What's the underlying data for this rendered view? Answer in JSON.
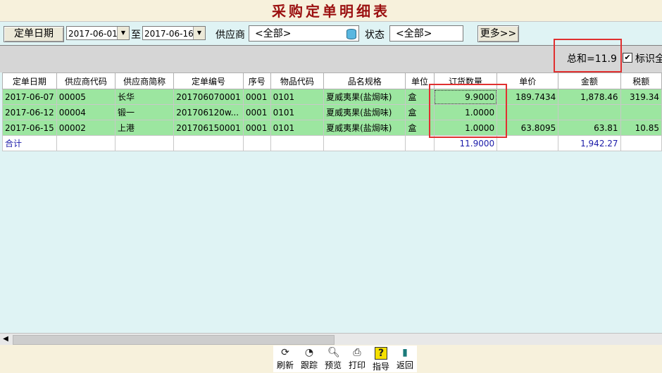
{
  "title": "采购定单明细表",
  "filters": {
    "date_label": "定单日期",
    "date_from": "2017-06-01",
    "to_label": "至",
    "date_to": "2017-06-16",
    "supplier_label": "供应商",
    "supplier_value": "<全部>",
    "status_label": "状态",
    "status_value": "<全部>",
    "more_label": "更多>>"
  },
  "summary": {
    "sum_text": "总和=11.9",
    "checkbox_label": "标识全"
  },
  "table": {
    "columns": [
      "定单日期",
      "供应商代码",
      "供应商简称",
      "定单编号",
      "序号",
      "物品代码",
      "品名规格",
      "单位",
      "订货数量",
      "单价",
      "金额",
      "税额"
    ],
    "rows": [
      [
        "2017-06-07",
        "00005",
        "长华",
        "201706070001",
        "0001",
        "0101",
        "夏威夷果(盐焗味)",
        "盒",
        "9.9000",
        "189.7434",
        "1,878.46",
        "319.34"
      ],
      [
        "2017-06-12",
        "00004",
        "锻一",
        "201706120w...",
        "0001",
        "0101",
        "夏威夷果(盐焗味)",
        "盒",
        "1.0000",
        "",
        "",
        " "
      ],
      [
        "2017-06-15",
        "00002",
        "上港",
        "201706150001",
        "0001",
        "0101",
        "夏威夷果(盐焗味)",
        "盒",
        "1.0000",
        "63.8095",
        "63.81",
        "10.85"
      ]
    ],
    "total": [
      "合计",
      "",
      "",
      "",
      "",
      "",
      "",
      "",
      "11.9000",
      "",
      "1,942.27",
      ""
    ]
  },
  "toolbar": [
    {
      "label": "刷新",
      "icon": "refresh-icon"
    },
    {
      "label": "跟踪",
      "icon": "pie-chart-icon"
    },
    {
      "label": "预览",
      "icon": "preview-icon"
    },
    {
      "label": "打印",
      "icon": "printer-icon"
    },
    {
      "label": "指导",
      "icon": "help-icon"
    },
    {
      "label": "返回",
      "icon": "exit-door-icon"
    }
  ]
}
